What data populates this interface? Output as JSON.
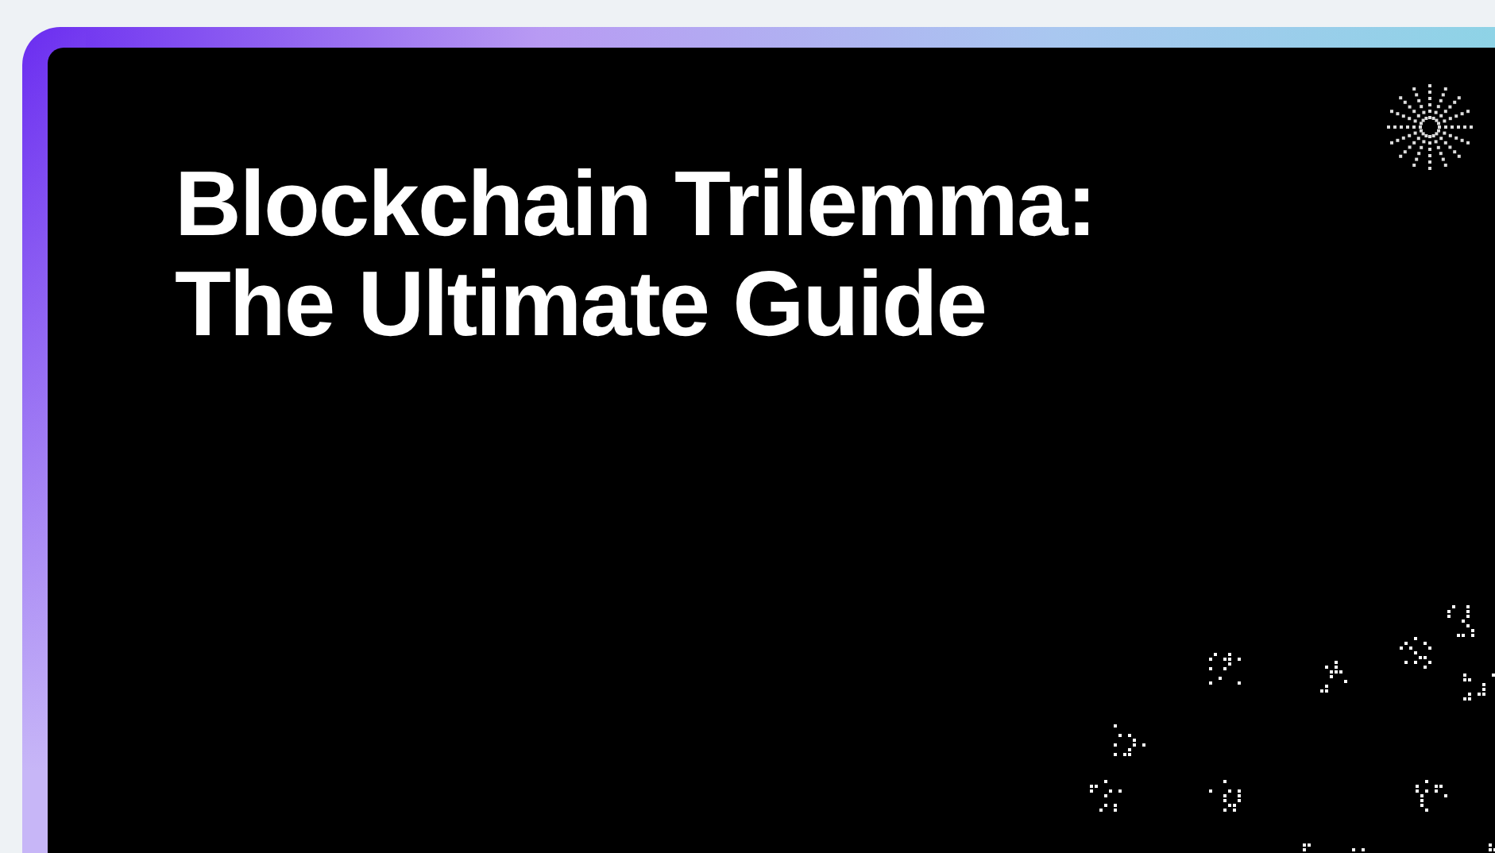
{
  "banner": {
    "title": "Blockchain Trilemma: The Ultimate Guide"
  }
}
